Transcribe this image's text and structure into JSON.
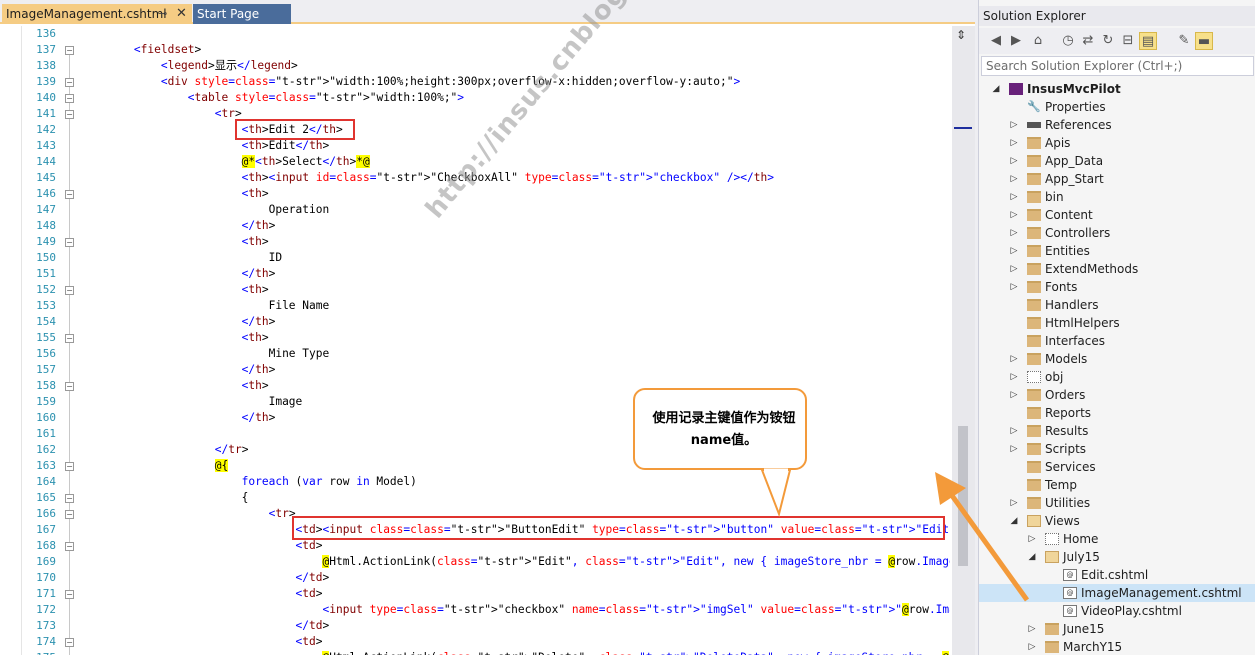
{
  "editor": {
    "tabs": [
      {
        "label": "ImageManagement.cshtml"
      },
      {
        "label": "Start Page"
      }
    ],
    "pin_glyph": "⊸",
    "close_glyph": "✕",
    "code_lines": [
      {
        "n": "136",
        "text": ""
      },
      {
        "n": "137",
        "text": "        <fieldset>"
      },
      {
        "n": "138",
        "text": "            <legend>显示</legend>"
      },
      {
        "n": "139",
        "text": "            <div style=\"width:100%;height:300px;overflow-x:hidden;overflow-y:auto;\">"
      },
      {
        "n": "140",
        "text": "                <table style=\"width:100%;\">"
      },
      {
        "n": "141",
        "text": "                    <tr>"
      },
      {
        "n": "142",
        "text": "                        <th>Edit 2</th>"
      },
      {
        "n": "143",
        "text": "                        <th>Edit</th>"
      },
      {
        "n": "144",
        "text": "                        @*<th>Select</th>*@"
      },
      {
        "n": "145",
        "text": "                        <th><input id=\"CheckboxAll\" type=\"checkbox\" /></th>"
      },
      {
        "n": "146",
        "text": "                        <th>"
      },
      {
        "n": "147",
        "text": "                            Operation"
      },
      {
        "n": "148",
        "text": "                        </th>"
      },
      {
        "n": "149",
        "text": "                        <th>"
      },
      {
        "n": "150",
        "text": "                            ID"
      },
      {
        "n": "151",
        "text": "                        </th>"
      },
      {
        "n": "152",
        "text": "                        <th>"
      },
      {
        "n": "153",
        "text": "                            File Name"
      },
      {
        "n": "154",
        "text": "                        </th>"
      },
      {
        "n": "155",
        "text": "                        <th>"
      },
      {
        "n": "156",
        "text": "                            Mine Type"
      },
      {
        "n": "157",
        "text": "                        </th>"
      },
      {
        "n": "158",
        "text": "                        <th>"
      },
      {
        "n": "159",
        "text": "                            Image"
      },
      {
        "n": "160",
        "text": "                        </th>"
      },
      {
        "n": "161",
        "text": ""
      },
      {
        "n": "162",
        "text": "                    </tr>"
      },
      {
        "n": "163",
        "text": "                    @{"
      },
      {
        "n": "164",
        "text": "                        foreach (var row in Model)"
      },
      {
        "n": "165",
        "text": "                        {"
      },
      {
        "n": "166",
        "text": "                            <tr>"
      },
      {
        "n": "167",
        "text": "                                <td><input class=\"ButtonEdit\" type=\"button\" value=\"Edit\" name=\"@row.ImageStore_nbr\" /></td>"
      },
      {
        "n": "168",
        "text": "                                <td>"
      },
      {
        "n": "169",
        "text": "                                    @Html.ActionLink(\"Edit\", \"Edit\", new { imageStore_nbr = @row.ImageStore_nbr })"
      },
      {
        "n": "170",
        "text": "                                </td>"
      },
      {
        "n": "171",
        "text": "                                <td>"
      },
      {
        "n": "172",
        "text": "                                    <input type=\"checkbox\" name=\"imgSel\" value=\"@row.ImageStore_nbr\" />"
      },
      {
        "n": "173",
        "text": "                                </td>"
      },
      {
        "n": "174",
        "text": "                                <td>"
      },
      {
        "n": "175",
        "text": "                                    @Html.ActionLink(\"Delete\", \"DeleteData\", new { imageStore_nbr = @row.ImageStore_nbr })"
      }
    ],
    "callout": "使用记录主键值作为铵钮name值。",
    "watermark": "http://insus.cnblogs.com"
  },
  "solution_explorer": {
    "title": "Solution Explorer",
    "search_placeholder": "Search Solution Explorer (Ctrl+;)",
    "toolbar_icons": [
      "back-icon",
      "forward-icon",
      "home-icon",
      "history-icon",
      "sync-icon",
      "refresh-icon",
      "collapse-all-icon",
      "show-all-files-icon",
      "properties-icon",
      "preview-icon"
    ],
    "tree": [
      {
        "label": "InsusMvcPilot",
        "kind": "project",
        "level": 0,
        "arrow": "◢",
        "bold": true
      },
      {
        "label": "Properties",
        "kind": "props",
        "level": 1,
        "arrow": ""
      },
      {
        "label": "References",
        "kind": "refs",
        "level": 1,
        "arrow": "▷"
      },
      {
        "label": "Apis",
        "kind": "folder",
        "level": 1,
        "arrow": "▷"
      },
      {
        "label": "App_Data",
        "kind": "folder",
        "level": 1,
        "arrow": "▷"
      },
      {
        "label": "App_Start",
        "kind": "folder",
        "level": 1,
        "arrow": "▷"
      },
      {
        "label": "bin",
        "kind": "folder",
        "level": 1,
        "arrow": "▷"
      },
      {
        "label": "Content",
        "kind": "folder",
        "level": 1,
        "arrow": "▷"
      },
      {
        "label": "Controllers",
        "kind": "folder",
        "level": 1,
        "arrow": "▷"
      },
      {
        "label": "Entities",
        "kind": "folder",
        "level": 1,
        "arrow": "▷"
      },
      {
        "label": "ExtendMethods",
        "kind": "folder",
        "level": 1,
        "arrow": "▷"
      },
      {
        "label": "Fonts",
        "kind": "folder",
        "level": 1,
        "arrow": "▷"
      },
      {
        "label": "Handlers",
        "kind": "folder",
        "level": 1,
        "arrow": ""
      },
      {
        "label": "HtmlHelpers",
        "kind": "folder",
        "level": 1,
        "arrow": ""
      },
      {
        "label": "Interfaces",
        "kind": "folder",
        "level": 1,
        "arrow": ""
      },
      {
        "label": "Models",
        "kind": "folder",
        "level": 1,
        "arrow": "▷"
      },
      {
        "label": "obj",
        "kind": "dotted",
        "level": 1,
        "arrow": "▷"
      },
      {
        "label": "Orders",
        "kind": "folder",
        "level": 1,
        "arrow": "▷"
      },
      {
        "label": "Reports",
        "kind": "folder",
        "level": 1,
        "arrow": ""
      },
      {
        "label": "Results",
        "kind": "folder",
        "level": 1,
        "arrow": "▷"
      },
      {
        "label": "Scripts",
        "kind": "folder",
        "level": 1,
        "arrow": "▷"
      },
      {
        "label": "Services",
        "kind": "folder",
        "level": 1,
        "arrow": ""
      },
      {
        "label": "Temp",
        "kind": "folder",
        "level": 1,
        "arrow": ""
      },
      {
        "label": "Utilities",
        "kind": "folder",
        "level": 1,
        "arrow": "▷"
      },
      {
        "label": "Views",
        "kind": "folder-open",
        "level": 1,
        "arrow": "◢"
      },
      {
        "label": "Home",
        "kind": "dotted",
        "level": 2,
        "arrow": "▷"
      },
      {
        "label": "July15",
        "kind": "folder-open",
        "level": 2,
        "arrow": "◢"
      },
      {
        "label": "Edit.cshtml",
        "kind": "cshtml",
        "level": 3,
        "arrow": ""
      },
      {
        "label": "ImageManagement.cshtml",
        "kind": "cshtml",
        "level": 3,
        "arrow": "",
        "selected": true
      },
      {
        "label": "VideoPlay.cshtml",
        "kind": "cshtml",
        "level": 3,
        "arrow": ""
      },
      {
        "label": "June15",
        "kind": "folder",
        "level": 2,
        "arrow": "▷"
      },
      {
        "label": "MarchY15",
        "kind": "folder",
        "level": 2,
        "arrow": "▷"
      }
    ]
  },
  "colors": {
    "accent_tab": "#f5cc84",
    "highlight_box": "#e0342f",
    "callout_border": "#f39a3a",
    "arrow": "#f39a3a",
    "selection": "#cce4f7"
  }
}
